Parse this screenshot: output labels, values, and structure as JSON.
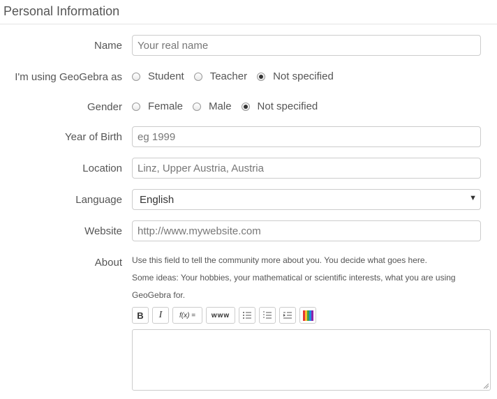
{
  "section": {
    "title": "Personal Information"
  },
  "form": {
    "name": {
      "label": "Name",
      "placeholder": "Your real name"
    },
    "role": {
      "label": "I'm using GeoGebra as",
      "options": [
        "Student",
        "Teacher",
        "Not specified"
      ],
      "selected": "Not specified"
    },
    "gender": {
      "label": "Gender",
      "options": [
        "Female",
        "Male",
        "Not specified"
      ],
      "selected": "Not specified"
    },
    "year_of_birth": {
      "label": "Year of Birth",
      "placeholder": "eg 1999"
    },
    "location": {
      "label": "Location",
      "placeholder": "Linz, Upper Austria, Austria"
    },
    "language": {
      "label": "Language",
      "value": "English"
    },
    "website": {
      "label": "Website",
      "placeholder": "http://www.mywebsite.com"
    },
    "about": {
      "label": "About",
      "help_line1": "Use this field to tell the community more about you. You decide what goes here.",
      "help_line2": "Some ideas: Your hobbies, your mathematical or scientific interests, what you are using GeoGebra for."
    }
  },
  "toolbar": {
    "bold": "B",
    "italic": "I",
    "formula": "f(x) =",
    "link": "www",
    "icons": [
      "bold-icon",
      "italic-icon",
      "formula-icon",
      "link-icon",
      "bullet-list-icon",
      "numbered-list-icon",
      "indent-list-icon",
      "color-icon"
    ]
  }
}
